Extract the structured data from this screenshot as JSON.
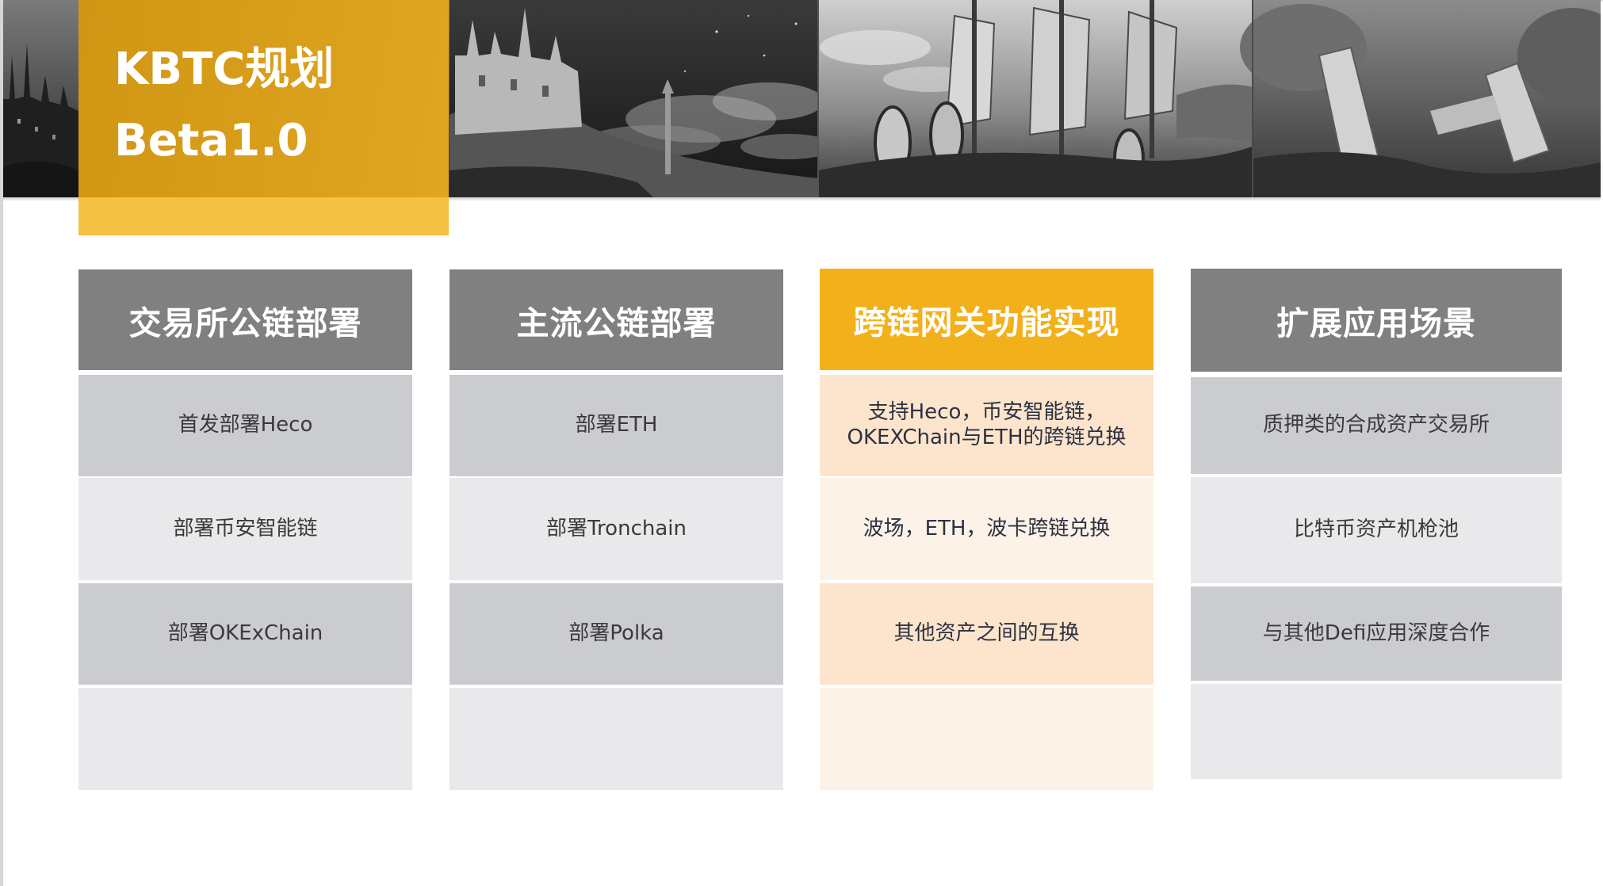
{
  "title": {
    "line1": "KBTC规划",
    "line2": "Beta1.0"
  },
  "columns": [
    {
      "header": "交易所公链部署",
      "items": [
        "首发部署Heco",
        "部署币安智能链",
        "部署OKExChain"
      ]
    },
    {
      "header": "主流公链部署",
      "items": [
        "部署ETH",
        "部署Tronchain",
        "部署Polka"
      ]
    },
    {
      "header": "跨链网关功能实现",
      "items": [
        "支持Heco，币安智能链，\nOKEXChain与ETH的跨链兑换",
        "波场，ETH，波卡跨链兑换",
        "其他资产之间的互换"
      ]
    },
    {
      "header": "扩展应用场景",
      "items": [
        "质押类的合成资产交易所",
        "比特币资产机枪池",
        "与其他Defi应用深度合作"
      ]
    }
  ],
  "colors": {
    "accent": "#f2b11a",
    "title_block": "#f4c142",
    "header_gray": "#808080",
    "row_gray": "#cbccd0",
    "row_light": "#e9e9eb",
    "row_peach": "#fce5cc"
  }
}
